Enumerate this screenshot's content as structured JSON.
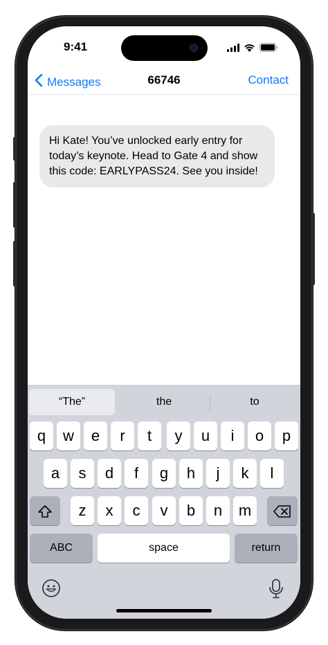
{
  "status_bar": {
    "time": "9:41",
    "signal_icon": "cellular-signal-icon",
    "wifi_icon": "wifi-icon",
    "battery_icon": "battery-icon"
  },
  "nav": {
    "back_label": "Messages",
    "title": "66746",
    "contact_label": "Contact",
    "accent_color": "#0a7aff"
  },
  "message": {
    "text": "Hi Kate! You’ve unlocked early entry for today’s keynote. Head to Gate 4 and show this code: EARLYPASS24. See you inside!",
    "bubble_color": "#e9e9eb"
  },
  "keyboard": {
    "suggestions": [
      "“The”",
      "the",
      "to"
    ],
    "row1": [
      "q",
      "w",
      "e",
      "r",
      "t",
      "y",
      "u",
      "i",
      "o",
      "p"
    ],
    "row2": [
      "a",
      "s",
      "d",
      "f",
      "g",
      "h",
      "j",
      "k",
      "l"
    ],
    "row3": [
      "z",
      "x",
      "c",
      "v",
      "b",
      "n",
      "m"
    ],
    "abc_label": "ABC",
    "space_label": "space",
    "return_label": "return",
    "shift_icon": "shift-icon",
    "delete_icon": "delete-icon",
    "emoji_icon": "emoji-icon",
    "mic_icon": "microphone-icon"
  }
}
